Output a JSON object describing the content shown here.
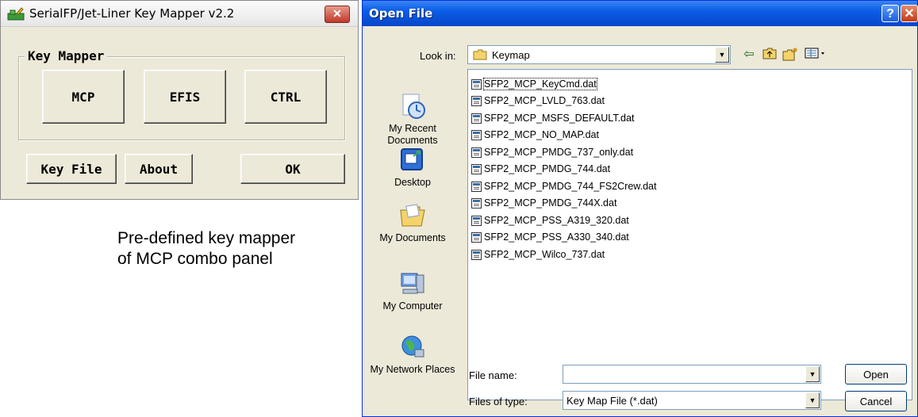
{
  "key_mapper": {
    "title": "SerialFP/Jet-Liner Key Mapper v2.2",
    "close_glyph": "✕",
    "group_label": "Key Mapper",
    "buttons": {
      "mcp": "MCP",
      "efis": "EFIS",
      "ctrl": "CTRL",
      "key_file": "Key File",
      "about": "About",
      "ok": "OK"
    }
  },
  "caption": {
    "line1": "Pre-defined key mapper",
    "line2": "of MCP combo panel"
  },
  "open_file": {
    "title": "Open File",
    "help_glyph": "?",
    "close_glyph": "✕",
    "look_in_label": "Look in:",
    "look_in_value": "Keymap",
    "toolbar_icons": [
      "back-icon",
      "up-folder-icon",
      "new-folder-icon",
      "view-menu-icon"
    ],
    "places": [
      {
        "label": "My Recent Documents",
        "icon": "recent-documents-icon"
      },
      {
        "label": "Desktop",
        "icon": "desktop-icon"
      },
      {
        "label": "My Documents",
        "icon": "my-documents-icon"
      },
      {
        "label": "My Computer",
        "icon": "my-computer-icon"
      },
      {
        "label": "My Network Places",
        "icon": "network-places-icon"
      }
    ],
    "files": [
      "SFP2_MCP_KeyCmd.dat",
      "SFP2_MCP_LVLD_763.dat",
      "SFP2_MCP_MSFS_DEFAULT.dat",
      "SFP2_MCP_NO_MAP.dat",
      "SFP2_MCP_PMDG_737_only.dat",
      "SFP2_MCP_PMDG_744.dat",
      "SFP2_MCP_PMDG_744_FS2Crew.dat",
      "SFP2_MCP_PMDG_744X.dat",
      "SFP2_MCP_PSS_A319_320.dat",
      "SFP2_MCP_PSS_A330_340.dat",
      "SFP2_MCP_Wilco_737.dat"
    ],
    "file_name_label": "File name:",
    "file_name_value": "",
    "files_of_type_label": "Files of type:",
    "files_of_type_value": "Key Map File (*.dat)",
    "open_label": "Open",
    "cancel_label": "Cancel",
    "colors": {
      "titlebar": "#0a5de6",
      "close": "#c23a14"
    }
  }
}
